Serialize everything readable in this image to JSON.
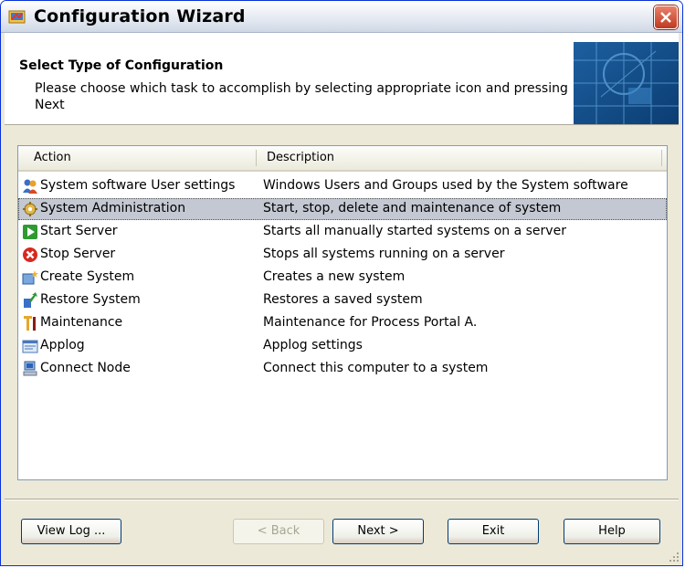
{
  "window": {
    "title": "Configuration Wizard"
  },
  "header": {
    "title": "Select Type of Configuration",
    "description": "Please choose which task to accomplish by selecting appropriate icon and pressing Next"
  },
  "list": {
    "columns": [
      "Action",
      "Description"
    ],
    "rows": [
      {
        "icon": "users-icon",
        "action": "System software User settings",
        "description": "Windows Users and Groups used by the System software"
      },
      {
        "icon": "admin-tools-icon",
        "action": "System Administration",
        "description": "Start, stop, delete and maintenance of system",
        "selected": true
      },
      {
        "icon": "start-icon",
        "action": "Start Server",
        "description": "Starts all manually started systems on a server"
      },
      {
        "icon": "stop-icon",
        "action": "Stop Server",
        "description": "Stops all systems running on a server"
      },
      {
        "icon": "create-system-icon",
        "action": "Create System",
        "description": "Creates a new system"
      },
      {
        "icon": "restore-icon",
        "action": "Restore System",
        "description": "Restores a saved system"
      },
      {
        "icon": "maintenance-icon",
        "action": "Maintenance",
        "description": "Maintenance for Process Portal A."
      },
      {
        "icon": "applog-icon",
        "action": "Applog",
        "description": "Applog settings"
      },
      {
        "icon": "connect-node-icon",
        "action": "Connect Node",
        "description": "Connect this computer to a system"
      }
    ]
  },
  "buttons": {
    "view_log": "View Log ...",
    "back": "< Back",
    "next": "Next >",
    "exit": "Exit",
    "help": "Help"
  }
}
